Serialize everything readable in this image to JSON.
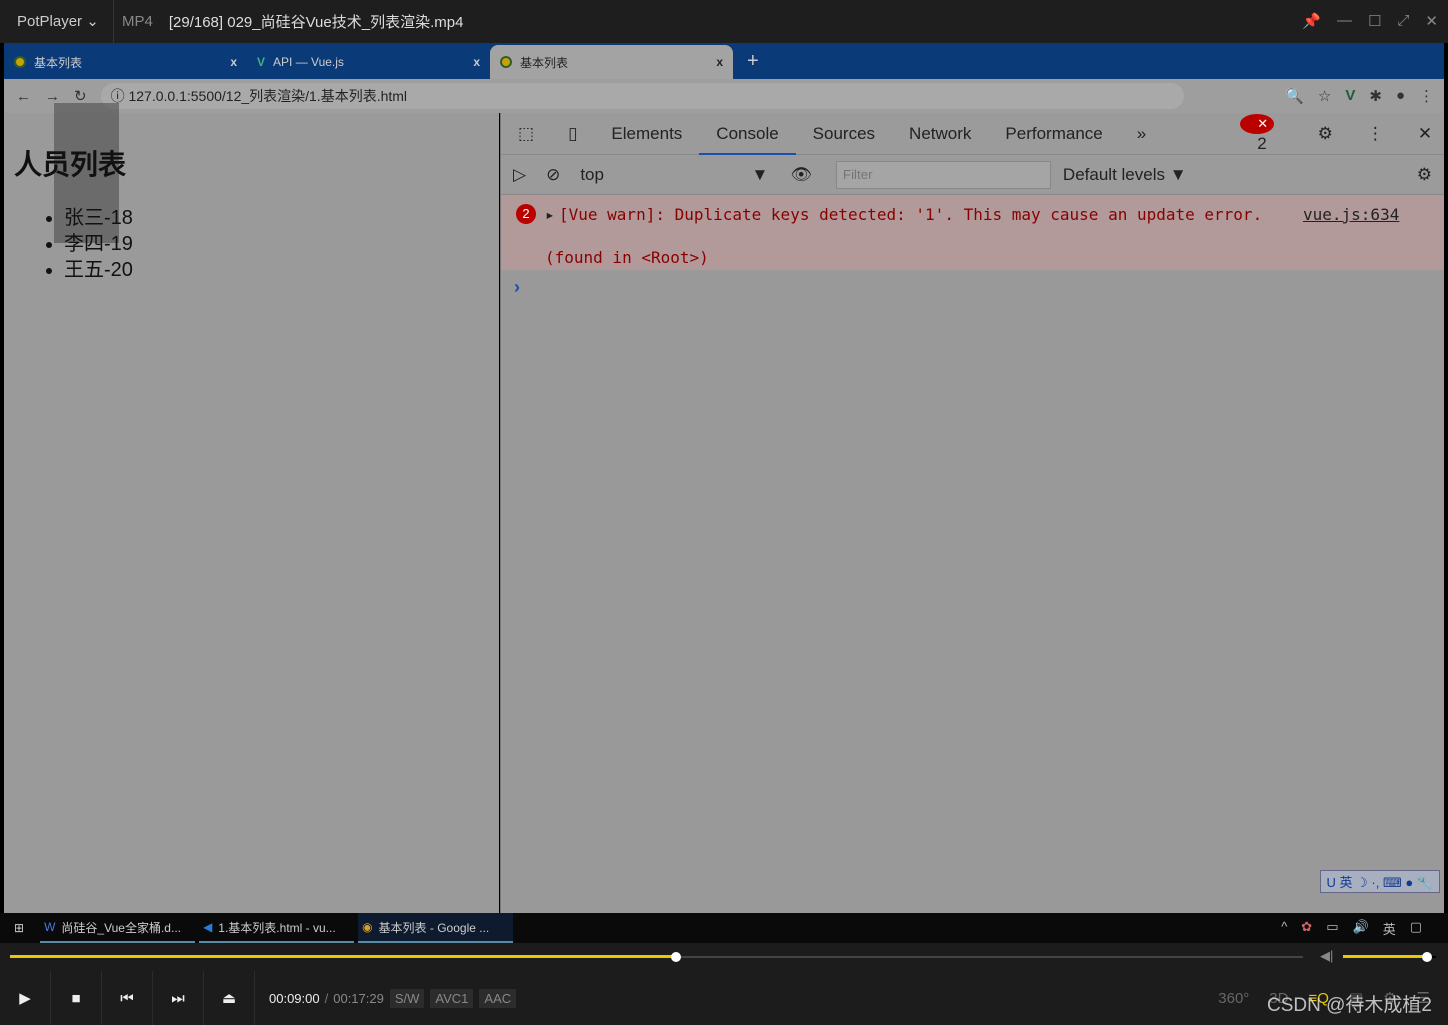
{
  "player": {
    "brand": "PotPlayer",
    "format": "MP4",
    "title": "[29/168] 029_尚硅谷Vue技术_列表渲染.mp4",
    "current_time": "00:09:00",
    "total_time": "00:17:29",
    "tags": [
      "S/W",
      "AVC1",
      "AAC"
    ],
    "progress": 0.515,
    "volume": 0.9,
    "accent": "#e8c800"
  },
  "browser": {
    "tabs": [
      {
        "label": "基本列表",
        "active": false
      },
      {
        "label": "API — Vue.js",
        "active": false
      },
      {
        "label": "基本列表",
        "active": true
      }
    ],
    "url": "127.0.0.1:5500/12_列表渲染/1.基本列表.html"
  },
  "page": {
    "heading": "人员列表",
    "items": [
      "张三-18",
      "李四-19",
      "王五-20"
    ]
  },
  "devtools": {
    "tabs": [
      "Elements",
      "Console",
      "Sources",
      "Network",
      "Performance"
    ],
    "active_tab": "Console",
    "error_count": "2",
    "context": "top",
    "filter_placeholder": "Filter",
    "levels": "Default levels ▼",
    "message": {
      "count": "2",
      "text": "[Vue warn]: Duplicate keys detected: '1'. This may cause an update error.",
      "source": "vue.js:634",
      "detail": "(found in <Root>)"
    },
    "prompt": "›"
  },
  "taskbar": {
    "items": [
      "尚硅谷_Vue全家桶.d...",
      "1.基本列表.html - vu...",
      "基本列表 - Google ..."
    ],
    "ime": "英"
  },
  "watermark": "CSDN @待木成植2"
}
